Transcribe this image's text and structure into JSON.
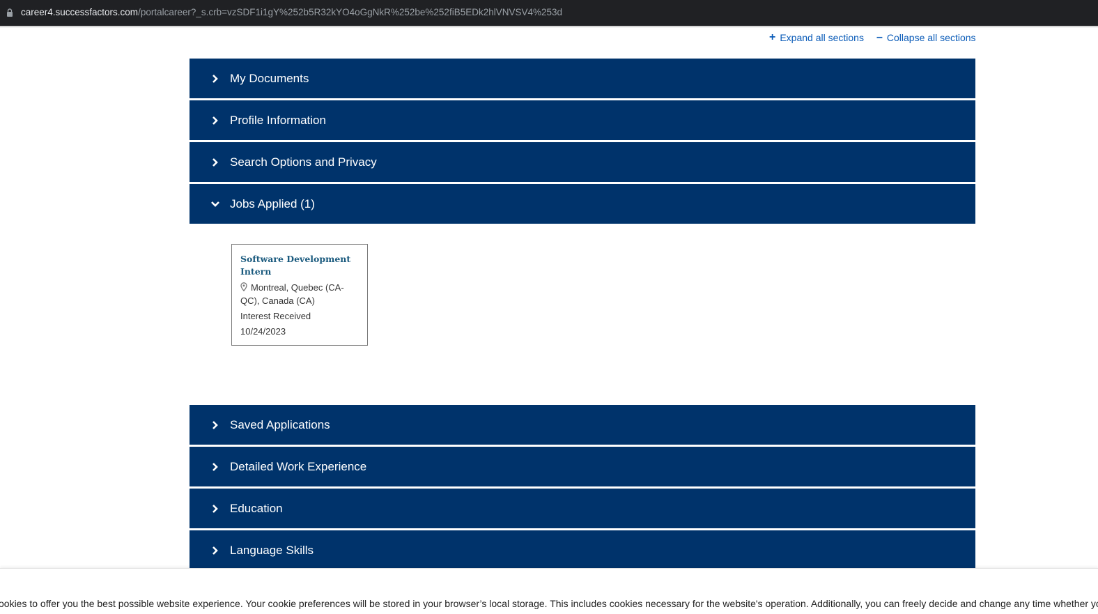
{
  "browser": {
    "url_host": "career4.successfactors.com",
    "url_path": "/portalcareer?_s.crb=vzSDF1i1gY%252b5R32kYO4oGgNkR%252be%252fiB5EDk2hlVNVSV4%253d"
  },
  "controls": {
    "expand_all": "Expand all sections",
    "collapse_all": "Collapse all sections"
  },
  "sections": [
    {
      "label": "My Documents",
      "expanded": false
    },
    {
      "label": "Profile Information",
      "expanded": false
    },
    {
      "label": "Search Options and Privacy",
      "expanded": false
    },
    {
      "label": "Jobs Applied (1)",
      "expanded": true
    },
    {
      "label": "Saved Applications",
      "expanded": false
    },
    {
      "label": "Detailed Work Experience",
      "expanded": false
    },
    {
      "label": "Education",
      "expanded": false
    },
    {
      "label": "Language Skills",
      "expanded": false
    }
  ],
  "job": {
    "title": "Software Development Intern",
    "location": "Montreal, Quebec (CA-QC), Canada (CA)",
    "status": "Interest Received",
    "date": "10/24/2023"
  },
  "cookie_banner": {
    "text": "ookies to offer you the best possible website experience. Your cookie preferences will be stored in your browser’s local storage. This includes cookies necessary for the website's operation. Additionally, you can freely decide and change any time whether yo"
  },
  "colors": {
    "section_bg": "#00336b",
    "link": "#0a5bb8",
    "job_title": "#1a5a7e"
  }
}
